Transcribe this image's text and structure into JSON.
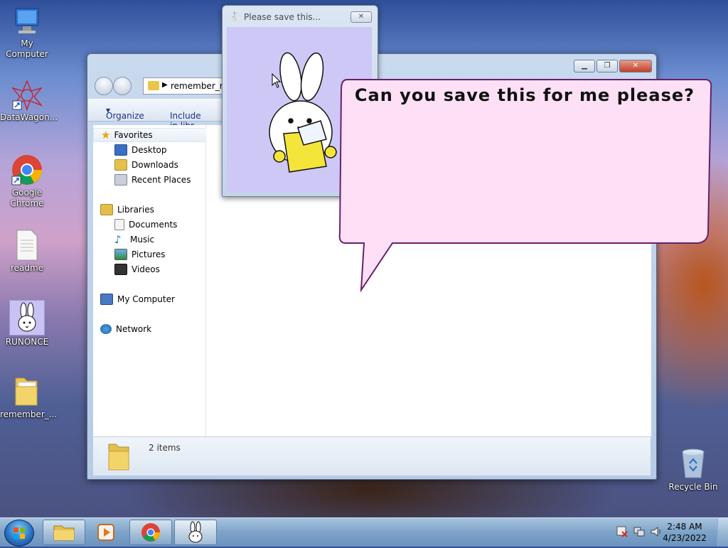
{
  "desktop": {
    "icons": [
      {
        "label": "My Computer"
      },
      {
        "label": "DataWagon..."
      },
      {
        "label": "Google Chrome"
      },
      {
        "label": "readme"
      },
      {
        "label": "RUNONCE"
      },
      {
        "label": "remember_..."
      },
      {
        "label": "Recycle Bin"
      }
    ]
  },
  "explorer": {
    "address": "remember_m",
    "toolbar": {
      "organize": "Organize",
      "include": "Include in libr"
    },
    "nav": {
      "favorites": "Favorites",
      "desktop": "Desktop",
      "downloads": "Downloads",
      "recent": "Recent Places",
      "libraries": "Libraries",
      "documents": "Documents",
      "music": "Music",
      "pictures": "Pictures",
      "videos": "Videos",
      "computer": "My Computer",
      "network": "Network"
    },
    "status": "2 items"
  },
  "dialog": {
    "title": "Please save this...",
    "message": "Can you save this for me please?"
  },
  "taskbar": {
    "time": "2:48 AM",
    "date": "4/23/2022"
  },
  "colors": {
    "bubble_fill": "#fde0f6",
    "bubble_stroke": "#6a1f6a",
    "dialog_bg": "#cdc8f5"
  }
}
